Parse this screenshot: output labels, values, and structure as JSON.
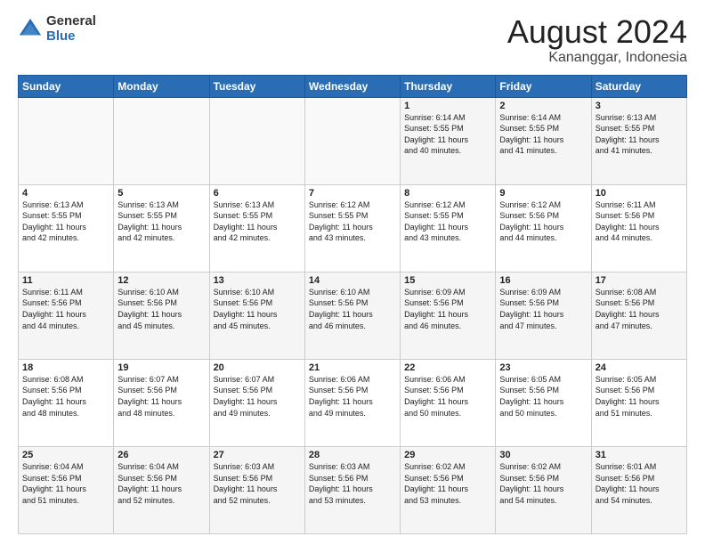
{
  "logo": {
    "general": "General",
    "blue": "Blue"
  },
  "title": "August 2024",
  "subtitle": "Kananggar, Indonesia",
  "days_header": [
    "Sunday",
    "Monday",
    "Tuesday",
    "Wednesday",
    "Thursday",
    "Friday",
    "Saturday"
  ],
  "weeks": [
    [
      {
        "day": "",
        "info": ""
      },
      {
        "day": "",
        "info": ""
      },
      {
        "day": "",
        "info": ""
      },
      {
        "day": "",
        "info": ""
      },
      {
        "day": "1",
        "info": "Sunrise: 6:14 AM\nSunset: 5:55 PM\nDaylight: 11 hours\nand 40 minutes."
      },
      {
        "day": "2",
        "info": "Sunrise: 6:14 AM\nSunset: 5:55 PM\nDaylight: 11 hours\nand 41 minutes."
      },
      {
        "day": "3",
        "info": "Sunrise: 6:13 AM\nSunset: 5:55 PM\nDaylight: 11 hours\nand 41 minutes."
      }
    ],
    [
      {
        "day": "4",
        "info": "Sunrise: 6:13 AM\nSunset: 5:55 PM\nDaylight: 11 hours\nand 42 minutes."
      },
      {
        "day": "5",
        "info": "Sunrise: 6:13 AM\nSunset: 5:55 PM\nDaylight: 11 hours\nand 42 minutes."
      },
      {
        "day": "6",
        "info": "Sunrise: 6:13 AM\nSunset: 5:55 PM\nDaylight: 11 hours\nand 42 minutes."
      },
      {
        "day": "7",
        "info": "Sunrise: 6:12 AM\nSunset: 5:55 PM\nDaylight: 11 hours\nand 43 minutes."
      },
      {
        "day": "8",
        "info": "Sunrise: 6:12 AM\nSunset: 5:55 PM\nDaylight: 11 hours\nand 43 minutes."
      },
      {
        "day": "9",
        "info": "Sunrise: 6:12 AM\nSunset: 5:56 PM\nDaylight: 11 hours\nand 44 minutes."
      },
      {
        "day": "10",
        "info": "Sunrise: 6:11 AM\nSunset: 5:56 PM\nDaylight: 11 hours\nand 44 minutes."
      }
    ],
    [
      {
        "day": "11",
        "info": "Sunrise: 6:11 AM\nSunset: 5:56 PM\nDaylight: 11 hours\nand 44 minutes."
      },
      {
        "day": "12",
        "info": "Sunrise: 6:10 AM\nSunset: 5:56 PM\nDaylight: 11 hours\nand 45 minutes."
      },
      {
        "day": "13",
        "info": "Sunrise: 6:10 AM\nSunset: 5:56 PM\nDaylight: 11 hours\nand 45 minutes."
      },
      {
        "day": "14",
        "info": "Sunrise: 6:10 AM\nSunset: 5:56 PM\nDaylight: 11 hours\nand 46 minutes."
      },
      {
        "day": "15",
        "info": "Sunrise: 6:09 AM\nSunset: 5:56 PM\nDaylight: 11 hours\nand 46 minutes."
      },
      {
        "day": "16",
        "info": "Sunrise: 6:09 AM\nSunset: 5:56 PM\nDaylight: 11 hours\nand 47 minutes."
      },
      {
        "day": "17",
        "info": "Sunrise: 6:08 AM\nSunset: 5:56 PM\nDaylight: 11 hours\nand 47 minutes."
      }
    ],
    [
      {
        "day": "18",
        "info": "Sunrise: 6:08 AM\nSunset: 5:56 PM\nDaylight: 11 hours\nand 48 minutes."
      },
      {
        "day": "19",
        "info": "Sunrise: 6:07 AM\nSunset: 5:56 PM\nDaylight: 11 hours\nand 48 minutes."
      },
      {
        "day": "20",
        "info": "Sunrise: 6:07 AM\nSunset: 5:56 PM\nDaylight: 11 hours\nand 49 minutes."
      },
      {
        "day": "21",
        "info": "Sunrise: 6:06 AM\nSunset: 5:56 PM\nDaylight: 11 hours\nand 49 minutes."
      },
      {
        "day": "22",
        "info": "Sunrise: 6:06 AM\nSunset: 5:56 PM\nDaylight: 11 hours\nand 50 minutes."
      },
      {
        "day": "23",
        "info": "Sunrise: 6:05 AM\nSunset: 5:56 PM\nDaylight: 11 hours\nand 50 minutes."
      },
      {
        "day": "24",
        "info": "Sunrise: 6:05 AM\nSunset: 5:56 PM\nDaylight: 11 hours\nand 51 minutes."
      }
    ],
    [
      {
        "day": "25",
        "info": "Sunrise: 6:04 AM\nSunset: 5:56 PM\nDaylight: 11 hours\nand 51 minutes."
      },
      {
        "day": "26",
        "info": "Sunrise: 6:04 AM\nSunset: 5:56 PM\nDaylight: 11 hours\nand 52 minutes."
      },
      {
        "day": "27",
        "info": "Sunrise: 6:03 AM\nSunset: 5:56 PM\nDaylight: 11 hours\nand 52 minutes."
      },
      {
        "day": "28",
        "info": "Sunrise: 6:03 AM\nSunset: 5:56 PM\nDaylight: 11 hours\nand 53 minutes."
      },
      {
        "day": "29",
        "info": "Sunrise: 6:02 AM\nSunset: 5:56 PM\nDaylight: 11 hours\nand 53 minutes."
      },
      {
        "day": "30",
        "info": "Sunrise: 6:02 AM\nSunset: 5:56 PM\nDaylight: 11 hours\nand 54 minutes."
      },
      {
        "day": "31",
        "info": "Sunrise: 6:01 AM\nSunset: 5:56 PM\nDaylight: 11 hours\nand 54 minutes."
      }
    ]
  ]
}
